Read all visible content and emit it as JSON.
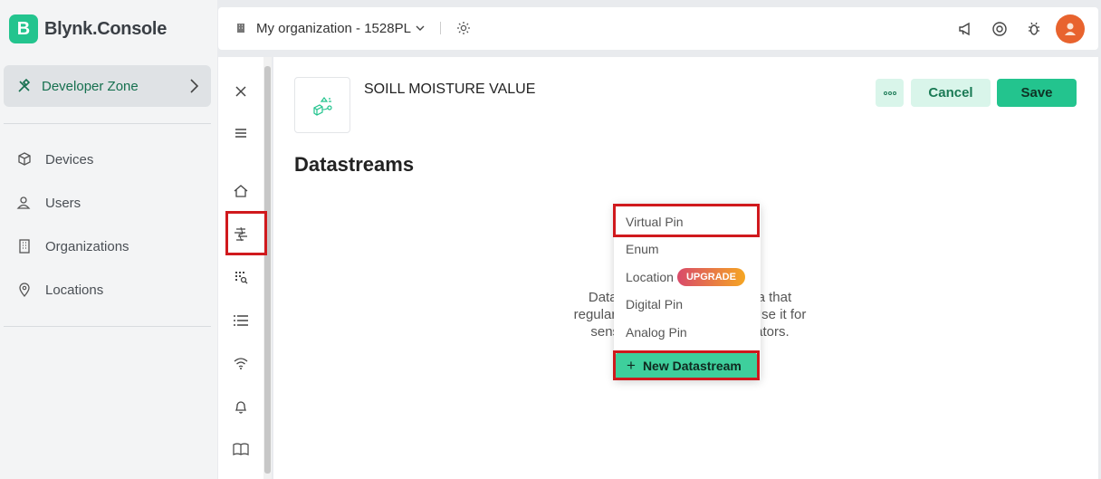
{
  "brand": {
    "logo_letter": "B",
    "name": "Blynk.Console"
  },
  "sidebar": {
    "developer_zone": "Developer Zone",
    "items": [
      {
        "label": "Devices",
        "icon": "cube-icon"
      },
      {
        "label": "Users",
        "icon": "users-icon"
      },
      {
        "label": "Organizations",
        "icon": "building-icon"
      },
      {
        "label": "Locations",
        "icon": "location-pin-icon"
      }
    ]
  },
  "topbar": {
    "org_label": "My organization - 1528PL"
  },
  "template": {
    "name": "SOILL MOISTURE VALUE"
  },
  "actions": {
    "cancel": "Cancel",
    "save": "Save"
  },
  "section_title": "Datastreams",
  "empty_state": {
    "line1": "Datastrear                    e data that",
    "line2": "regularly flov                     ce. Use it for",
    "line3": "sensor da                       ctuators."
  },
  "dropdown": {
    "items": [
      "Virtual Pin",
      "Enum",
      "Location",
      "Digital Pin",
      "Analog Pin"
    ],
    "upgrade_badge": "UPGRADE",
    "action_label": "New Datastream"
  },
  "colors": {
    "accent": "#23c48e",
    "highlight": "#d0191d"
  }
}
